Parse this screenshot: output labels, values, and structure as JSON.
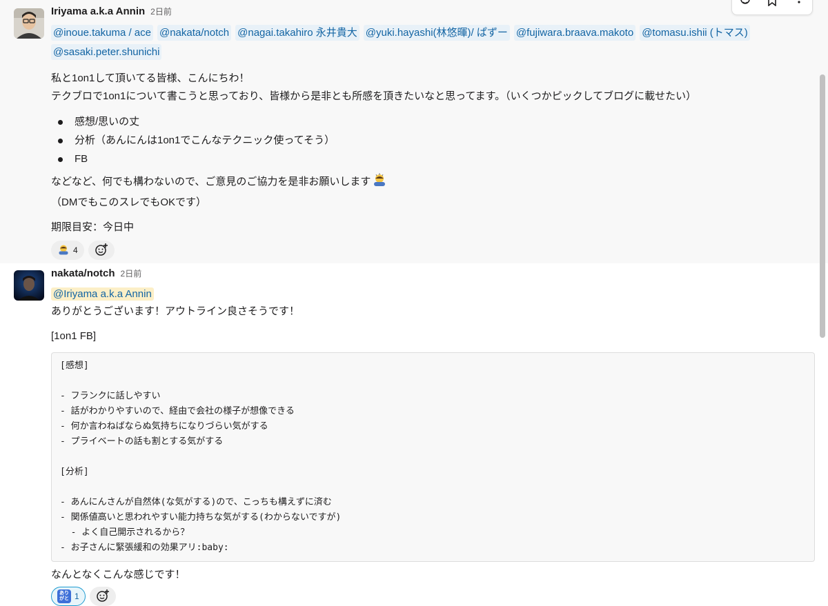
{
  "message1": {
    "author": "Iriyama a.k.a Annin",
    "time": "2日前",
    "mentions": [
      "@inoue.takuma / ace",
      "@nakata/notch",
      "@nagai.takahiro 永井貴大",
      "@yuki.hayashi(林悠暉)/ ぱずー",
      "@fujiwara.braava.makoto",
      "@tomasu.ishii (トマス)",
      "@sasaki.peter.shunichi"
    ],
    "intro_line1": "私と1on1して頂いてる皆様、こんにちわ！",
    "intro_line2": "テクブロで1on1について書こうと思っており、皆様から是非とも所感を頂きたいなと思ってます。（いくつかピックしてブログに載せたい）",
    "bullets": [
      "感想/思いの丈",
      "分析（あんにんは1on1でこんなテクニック使ってそう）",
      "FB"
    ],
    "closing_line1": "などなど、何でも構わないので、ご意見のご協力を是非お願いします",
    "closing_line2": "（DMでもこのスレでもOKです）",
    "deadline": "期限目安：今日中",
    "reaction_count": "4"
  },
  "message2": {
    "author": "nakata/notch",
    "time": "2日前",
    "mention": "@Iriyama a.k.a Annin",
    "thanks": "ありがとうございます！アウトライン良さそうです！",
    "fb_label": "[1on1 FB]",
    "code_lines": [
      "[感想]",
      "",
      "- フランクに話しやすい",
      "- 話がわかりやすいので、経由で会社の様子が想像できる",
      "- 何か言わねばならぬ気持ちになりづらい気がする",
      "- プライベートの話も割とする気がする",
      "",
      "[分析]",
      "",
      "- あんにんさんが自然体(な気がする)ので、こっちも構えずに済む",
      "- 関係値高いと思われやすい能力持ちな気がする(わからないですが)",
      "  - よく自己開示されるから？",
      "- お子さんに緊張緩和の効果アリ:baby:"
    ],
    "closing": "なんとなくこんな感じです！",
    "reaction_label": "ありがと",
    "reaction_count": "1"
  },
  "icons": [
    "add-reaction-icon",
    "bookmark-icon",
    "more-vertical-icon",
    "bow-emoji-icon",
    "thanks-emoji-icon"
  ],
  "colors": {
    "mention_text": "#1264a3",
    "mention_bg": "#e8f1f8",
    "self_mention_bg": "#fcefc7",
    "own_reaction_border": "#1d9bd1"
  }
}
